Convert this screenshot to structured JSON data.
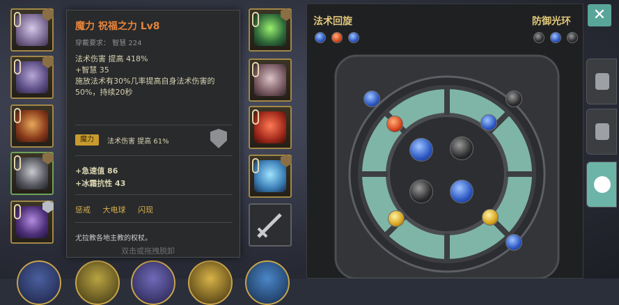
{
  "tooltip": {
    "title": "魔力 祝福之力 Lv8",
    "requirement": "穿戴要求：    智慧 224",
    "stats": [
      "法术伤害 提高 418%",
      "+智慧 35",
      "施放法术有30%几率提高自身法术伤害的50%，持续20秒"
    ],
    "tag_label": "魔力",
    "tag_text": "法术伤害 提高 61%",
    "bonuses": [
      "+急速值 86",
      "+冰霜抗性 43"
    ],
    "skills": [
      "惩戒",
      "大电球",
      "闪现"
    ],
    "description": "尤拉教各地主教的权杖。"
  },
  "hint": "双击或拖拽脱卸",
  "panel": {
    "title_left": "法术回旋",
    "title_right": "防御光环"
  },
  "close_label": "✕",
  "colors": {
    "tooltip_title": "#e6843a",
    "accent_gold": "#e0c77a",
    "close_button": "#5aa59a"
  },
  "icons": {
    "close": "close-icon",
    "helmet": "helmet-icon",
    "gloves": "gloves-icon",
    "target": "target-icon",
    "sword": "sword-icon",
    "lock": "lock-icon"
  }
}
